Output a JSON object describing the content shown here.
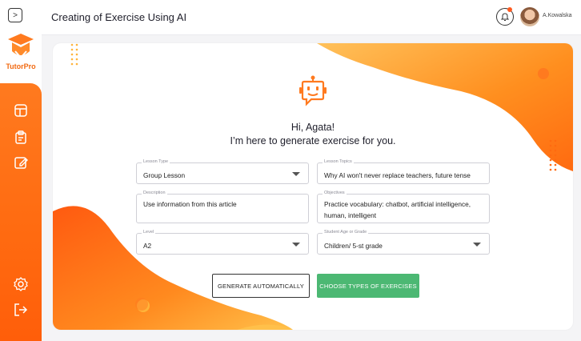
{
  "app": {
    "brand": "TutorPro",
    "title": "Creating of Exercise Using AI"
  },
  "user": {
    "name": "A.Kowalska"
  },
  "colors": {
    "accent": "#ff6a10",
    "green": "#4cb873"
  },
  "sidebar": {
    "items": [
      {
        "icon": "layout-icon"
      },
      {
        "icon": "clipboard-icon"
      },
      {
        "icon": "edit-icon"
      }
    ],
    "bottom": [
      {
        "icon": "settings-icon"
      },
      {
        "icon": "logout-icon"
      }
    ]
  },
  "greeting": {
    "line1": "Hi, Agata!",
    "line2": "I’m here to generate exercise for you."
  },
  "form": {
    "lesson_type": {
      "label": "Lesson Type",
      "value": "Group Lesson"
    },
    "lesson_topics": {
      "label": "Lesson Topics",
      "value": "Why AI won't never replace teachers, future tense"
    },
    "description": {
      "label": "Description",
      "value": "Use information from this article"
    },
    "objectives": {
      "label": "Objectives",
      "value": "Practice vocabulary: chatbot, artificial intelligence, human, intelligent"
    },
    "level": {
      "label": "Level",
      "value": "A2"
    },
    "student_age": {
      "label": "Student Age or Grade",
      "value": "Children/ 5-st grade"
    }
  },
  "actions": {
    "generate": "GENERATE AUTOMATICALLY",
    "choose": "CHOOSE TYPES OF EXERCISES"
  }
}
